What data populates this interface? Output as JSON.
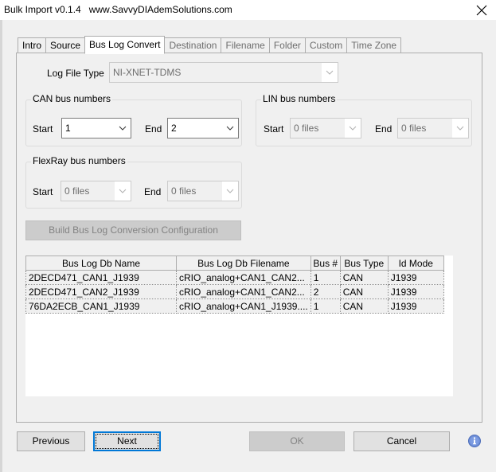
{
  "window": {
    "title": "Bulk Import v0.1.4   www.SavvyDIAdemSolutions.com",
    "close_icon": "close-x"
  },
  "tabs": [
    {
      "label": "Intro",
      "state": "enabled"
    },
    {
      "label": "Source",
      "state": "enabled"
    },
    {
      "label": "Bus Log Convert",
      "state": "active"
    },
    {
      "label": "Destination",
      "state": "disabled"
    },
    {
      "label": "Filename",
      "state": "disabled"
    },
    {
      "label": "Folder",
      "state": "disabled"
    },
    {
      "label": "Custom",
      "state": "disabled"
    },
    {
      "label": "Time Zone",
      "state": "disabled"
    }
  ],
  "log_file_type": {
    "label": "Log File Type",
    "value": "NI-XNET-TDMS"
  },
  "can": {
    "legend": "CAN bus numbers",
    "start_label": "Start",
    "start_value": "1",
    "end_label": "End",
    "end_value": "2"
  },
  "lin": {
    "legend": "LIN bus numbers",
    "start_label": "Start",
    "start_value": "0 files",
    "end_label": "End",
    "end_value": "0 files"
  },
  "flexray": {
    "legend": "FlexRay bus numbers",
    "start_label": "Start",
    "start_value": "0 files",
    "end_label": "End",
    "end_value": "0 files"
  },
  "build_button": "Build Bus Log Conversion Configuration",
  "grid": {
    "columns": [
      "Bus Log Db Name",
      "Bus Log Db Filename",
      "Bus #",
      "Bus Type",
      "Id Mode"
    ],
    "rows": [
      [
        "2DECD471_CAN1_J1939",
        "cRIO_analog+CAN1_CAN2...",
        "1",
        "CAN",
        "J1939"
      ],
      [
        "2DECD471_CAN2_J1939",
        "cRIO_analog+CAN1_CAN2...",
        "2",
        "CAN",
        "J1939"
      ],
      [
        "76DA2ECB_CAN1_J1939",
        "cRIO_analog+CAN1_J1939....",
        "1",
        "CAN",
        "J1939"
      ]
    ]
  },
  "footer": {
    "previous": "Previous",
    "next": "Next",
    "ok": "OK",
    "cancel": "Cancel",
    "info_icon": "info"
  },
  "colors": {
    "focus_border": "#0078d7",
    "info_icon": "#6f8fd8"
  }
}
